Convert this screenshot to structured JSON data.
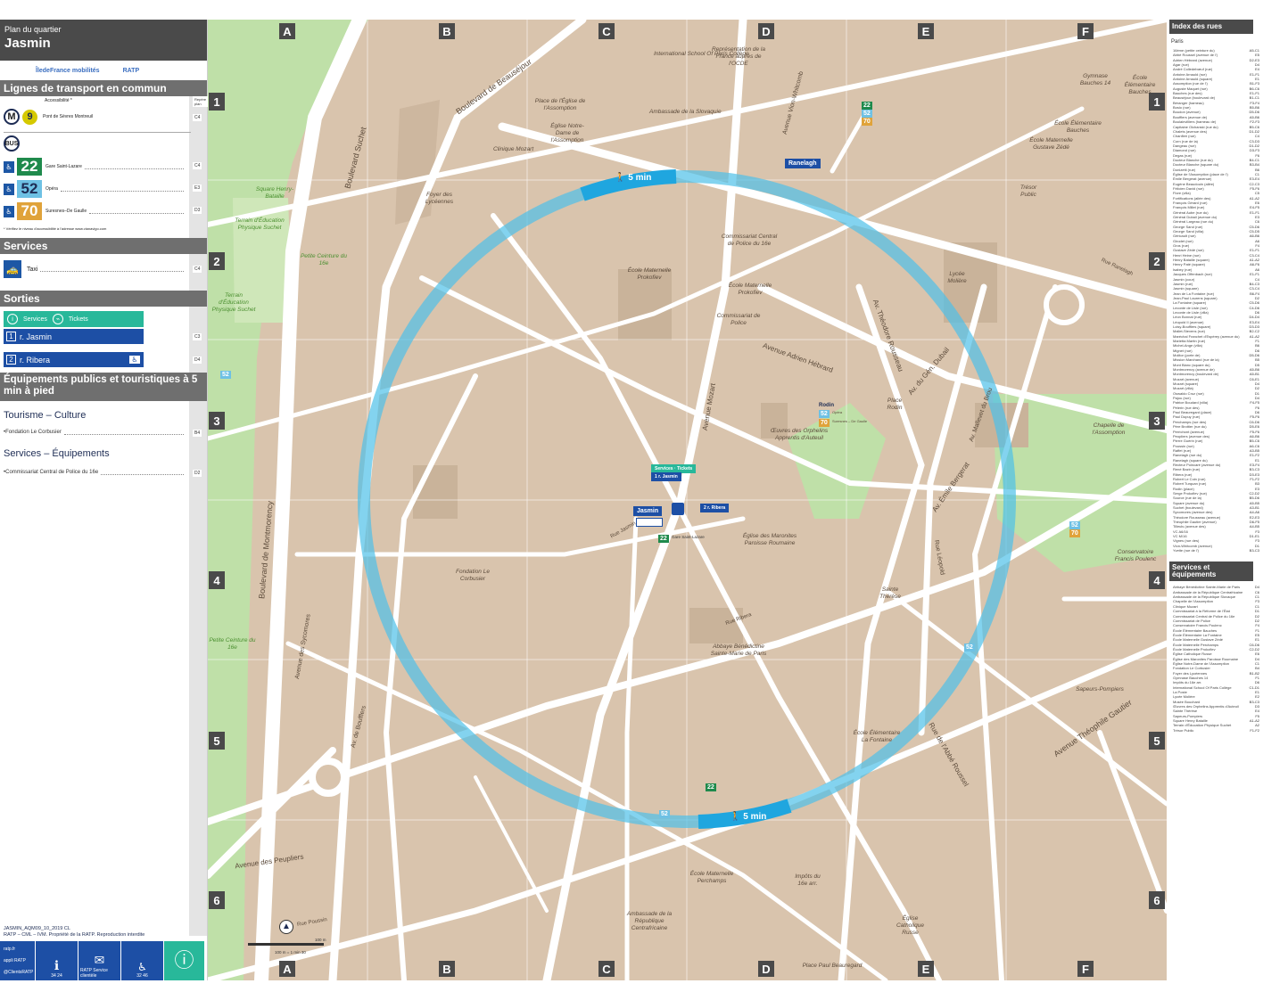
{
  "header": {
    "subtitle": "Plan du quartier",
    "title": "Jasmin"
  },
  "logos": {
    "idf": "ÎledeFrance mobilités",
    "ratp": "RATP"
  },
  "transport": {
    "section": "Lignes de transport en commun",
    "refs_label": "Repère plan",
    "accessibility_label": "Accessibilité *",
    "metro": {
      "line": "9",
      "direction": "Pont de Sèvres Montreuil",
      "ref": "C4"
    },
    "bus_label": "BUS",
    "bus_lines": [
      {
        "line": "22",
        "color": "#1f8a4c",
        "dest": "Gare Saint-Lazare",
        "ref": "C4"
      },
      {
        "line": "52",
        "color": "#6ec1e4",
        "dest": "Opéra",
        "ref": "E3"
      },
      {
        "line": "70",
        "color": "#e0a33a",
        "dest": "Suresnes–De Gaulle",
        "ref": "D3"
      }
    ],
    "note": "* Vérifiez le niveau d'accessibilité à l'adresse www.vianavigo.com"
  },
  "services": {
    "section": "Services",
    "taxi": "Taxi",
    "taxi_ref": "C4"
  },
  "exits": {
    "section": "Sorties",
    "services_btn": "Services",
    "tickets_btn": "Tickets",
    "list": [
      {
        "num": "1",
        "label": "r. Jasmin",
        "ref": "C3"
      },
      {
        "num": "2",
        "label": "r. Ribera",
        "ref": "D4"
      }
    ]
  },
  "equipements": {
    "section": "Équipements publics et touristiques à 5 min à pied",
    "tourisme": "Tourisme – Culture",
    "tourisme_items": [
      {
        "label": "Fondation Le Corbusier",
        "ref": "B4"
      }
    ],
    "servequip": "Services – Équipements",
    "servequip_items": [
      {
        "label": "Commissariat Central de Police du 16e",
        "ref": "D2"
      }
    ]
  },
  "footer": {
    "line1": "JASMIN_AQM09_10_2019 CL",
    "line2": "RATP – CML – IVM. Propriété de la RATP. Reproduction interdite",
    "contacts": [
      "ratp.fr",
      "appli RATP",
      "@ClientsRATP",
      "34 24",
      "RATP Service clientèle",
      "32 46"
    ]
  },
  "map": {
    "columns": [
      "A",
      "B",
      "C",
      "D",
      "E",
      "F"
    ],
    "rows": [
      "1",
      "2",
      "3",
      "4",
      "5",
      "6"
    ],
    "walk_label": "5 min",
    "station": "Jasmin",
    "station_exit1": "r. Jasmin",
    "station_exit2": "r. Ribera",
    "bus_stop_gsl": "Gare Saint-Lazare",
    "ranelagh": "Ranelagh",
    "rodin": "Rodin",
    "rodin_opera": "Opéra",
    "rodin_suresnes": "Suresnes – De Gaulle",
    "streets": [
      "Boulevard de Beauséjour",
      "Boulevard Suchet",
      "Boulevard de Montmorency",
      "Avenue Mozart",
      "Avenue Adrien Hébrard",
      "Av. Théodore Rousseau",
      "Av. du Gén. Dubail",
      "Av. Émile Bergerat",
      "Av. Mallevet du Brou",
      "Avenue Théophile Gautier",
      "Rue de l'Abbé Roussel",
      "Avenue des Peupliers",
      "Avenue des Sycomores",
      "Av. de Boufflers",
      "Rue Ranelagh",
      "Rue Poussin",
      "Rue Jasmin",
      "Rue Ribera",
      "Rue Poussin",
      "Rue Raffet",
      "Rue du Docteur Blanche",
      "Rue Henri Heine",
      "Rue Leconte de Lisle",
      "Rue George Sand",
      "Rue Perchamps",
      "Rue Léopold",
      "Rue de l'Assomption",
      "Avenue Vion-Whitcomb",
      "Rue Poussin",
      "Rue Mallet-Stevens",
      "Rue du Docteur Blanche",
      "Avenue des Tilleuls",
      "Rue Raffet",
      "Rue Leconte de Lisle",
      "Rue Théodore Rousseau"
    ],
    "places": [
      "International School Of Paris Collège",
      "Représentation de la France auprès de l'OCDE",
      "Ambassade de Slovaquie",
      "Ambassade de la Slovaquie",
      "Place de l'Église de l'Assomption",
      "Église Notre-Dame de l'Assomption",
      "Clinique Mozart",
      "Foyer des Lycéennes",
      "Square Henry-Bataille",
      "Terrain d'Éducation Physique Suchet",
      "Petite Ceinture du 16e",
      "Terrain d'Éducation Physique Suchet",
      "Commissariat Central de Police du 16e",
      "École Maternelle Prokofiev",
      "École Maternelle Prokofiev",
      "Commissariat de Police",
      "Lycée Molière",
      "Trésor Public",
      "Gymnase Bauches 14",
      "École Élémentaire Bauches",
      "École Élémentaire Bauches",
      "École Maternelle Gustave Zédé",
      "Chapelle de l'Assomption",
      "Œuvres des Orphelins Apprentis d'Auteuil",
      "Église des Maronites Paroisse Roumaine",
      "Fondation Le Corbusier",
      "Sainte Thérèse",
      "Conservatoire Francis Poulenc",
      "Abbaye Bénédictine Sainte-Marie de Paris",
      "Sapeurs-Pompiers",
      "École Élémentaire La Fontaine",
      "École Maternelle Perchamps",
      "Ambassade de la République Centrafricaine",
      "Impôts du 16e arr.",
      "Église Catholique Russe",
      "Petite Ceinture du 16e",
      "Place Rodin",
      "Place Paul Beauregard",
      "Villa de la Réunion",
      "Place de l'Église"
    ],
    "scale": "100 m = 1 min 30",
    "scale_end": "100 m"
  },
  "index": {
    "title": "Index des rues",
    "city": "Paris",
    "streets": [
      [
        "16ème (petite ceinture du)",
        "A5-C1"
      ],
      [
        "Abbé Roussel (avenue de l')",
        "E5"
      ],
      [
        "Adrien Hébrard (avenue)",
        "D2-E3"
      ],
      [
        "Agar (rue)",
        "D4"
      ],
      [
        "André Colledebœuf (rue)",
        "E4"
      ],
      [
        "Antoine Arnauld (rue)",
        "E1-F1"
      ],
      [
        "Antoine Arnauld (square)",
        "E1"
      ],
      [
        "Assomption (rue de l')",
        "B1-F3"
      ],
      [
        "Auguste Maquet (rue)",
        "B6-C6"
      ],
      [
        "Bauches (rue des)",
        "E1-F1"
      ],
      [
        "Beauséjour (boulevard de)",
        "B1-C1"
      ],
      [
        "Béranger (hameau)",
        "F3-F4"
      ],
      [
        "Bosio (rue)",
        "B5-B6"
      ],
      [
        "Boudon (avenue)",
        "D5-D6"
      ],
      [
        "Boufflers (avenue de)",
        "A5-B6"
      ],
      [
        "Boulainvilliers (hameau de)",
        "F2-F3"
      ],
      [
        "Capitaine Olchanski (rue du)",
        "B5-C6"
      ],
      [
        "Chalets (avenue des)",
        "D1-D2"
      ],
      [
        "Chanfleri (rue)",
        "C4"
      ],
      [
        "Corn (rue de la)",
        "C3-D3"
      ],
      [
        "Dangeau (rue)",
        "D1-D2"
      ],
      [
        "Diamond (rue)",
        "D3-F3"
      ],
      [
        "Degas (rue)",
        "F6"
      ],
      [
        "Docteur Blanche (rue du)",
        "B4-C1"
      ],
      [
        "Docteur Blanche (square du)",
        "B3-B4"
      ],
      [
        "Donizetti (rue)",
        "B6"
      ],
      [
        "Église de l'Assomption (place de l')",
        "C1"
      ],
      [
        "Émile Bergerat (avenue)",
        "E3-E4"
      ],
      [
        "Eugène Beaudouin (allée)",
        "C2-C3"
      ],
      [
        "Félicien David (rue)",
        "F5-F6"
      ],
      [
        "Flore (villa)",
        "C5"
      ],
      [
        "Fortifications (allée des)",
        "A1-A2"
      ],
      [
        "François Gérard (rue)",
        "E6"
      ],
      [
        "François Millet (rue)",
        "E4-F5"
      ],
      [
        "Général Aube (rue du)",
        "E1-F1"
      ],
      [
        "Général Dubail (avenue du)",
        "E3"
      ],
      [
        "Général Largeau (rue du)",
        "C6"
      ],
      [
        "George Sand (rue)",
        "C5-D6"
      ],
      [
        "George Sand (villa)",
        "C5-D5"
      ],
      [
        "Géricault (rue)",
        "A6-B6"
      ],
      [
        "Girodet (rue)",
        "A6"
      ],
      [
        "Gros (rue)",
        "F4"
      ],
      [
        "Gustave Zédé (rue)",
        "E1-F1"
      ],
      [
        "Henri Heine (rue)",
        "C3-C4"
      ],
      [
        "Henry Bataille (square)",
        "A1-A2"
      ],
      [
        "Henry Paté (square)",
        "A6-F6"
      ],
      [
        "Isabey (rue)",
        "A6"
      ],
      [
        "Jacques Offenbach (rue)",
        "E1-F1"
      ],
      [
        "Jasmin (cour)",
        "C4"
      ],
      [
        "Jasmin (rue)",
        "B4-C3"
      ],
      [
        "Jasmin (square)",
        "C3-C4"
      ],
      [
        "Jean de La Fontaine (rue)",
        "B6-F4"
      ],
      [
        "Jean-Paul Laurens (square)",
        "D2"
      ],
      [
        "La Fontaine (square)",
        "C5-D6"
      ],
      [
        "Leconte de Lisle (rue)",
        "C4-D6"
      ],
      [
        "Leconte de Lisle (villa)",
        "D6"
      ],
      [
        "Léon Bonnat (rue)",
        "D4-D4"
      ],
      [
        "Léopold II (avenue)",
        "E3-E4"
      ],
      [
        "Loisy-Boufflers (square)",
        "D3-D3"
      ],
      [
        "Mallet-Stevens (rue)",
        "B2-C2"
      ],
      [
        "Maréchal Franchet d'Espérey (avenue du)",
        "A1-A2"
      ],
      [
        "Marietta Martin (rue)",
        "F1"
      ],
      [
        "Michel-Ange (villa)",
        "B6"
      ],
      [
        "Mignet (rue)",
        "D6"
      ],
      [
        "Molitor (porte de)",
        "D5-D6"
      ],
      [
        "Mission Marchand (rue de la)",
        "B5"
      ],
      [
        "Mont Blanc (square du)",
        "D5"
      ],
      [
        "Montmorency (avenue de)",
        "A5-B6"
      ],
      [
        "Montmorency (boulevard de)",
        "A5-B1"
      ],
      [
        "Mozart (avenue)",
        "C6-E1"
      ],
      [
        "Mozart (square)",
        "D4"
      ],
      [
        "Mozart (villa)",
        "D2"
      ],
      [
        "Oswaldo Cruz (rue)",
        "D1"
      ],
      [
        "Pajou (rue)",
        "D4"
      ],
      [
        "Patrice Boudard (villa)",
        "F4-F5"
      ],
      [
        "Pèlerin (rue des)",
        "F6"
      ],
      [
        "Paul Beauregard (place)",
        "D6"
      ],
      [
        "Paul Dupuy (rue)",
        "F5-F6"
      ],
      [
        "Perchamps (rue des)",
        "C6-D6"
      ],
      [
        "Père Brottier (rue du)",
        "D5-E6"
      ],
      [
        "Perrichont (avenue)",
        "F5-F6"
      ],
      [
        "Peupliers (avenue des)",
        "A6-B6"
      ],
      [
        "Pierre Guérin (rue)",
        "B5-C6"
      ],
      [
        "Poussin (rue)",
        "A6-C6"
      ],
      [
        "Raffet (rue)",
        "A3-B5"
      ],
      [
        "Ranelagh (rue du)",
        "E1-F2"
      ],
      [
        "Ranelagh (square du)",
        "E1"
      ],
      [
        "Recteur Poincaré (avenue du)",
        "E3-F4"
      ],
      [
        "René Bazin (rue)",
        "B3-C3"
      ],
      [
        "Ribera (rue)",
        "D3-E3"
      ],
      [
        "Robert Le Coin (rue)",
        "F1-F2"
      ],
      [
        "Robert Turquan (rue)",
        "B3"
      ],
      [
        "Rodin (place)",
        "E3"
      ],
      [
        "Serge Prokofiev (rue)",
        "C2-D2"
      ],
      [
        "Source (rue de la)",
        "B5-D6"
      ],
      [
        "Square (avenue du)",
        "A5-B5"
      ],
      [
        "Suchet (boulevard)",
        "A3-B1"
      ],
      [
        "Sycomores (avenue des)",
        "A4-A6"
      ],
      [
        "Théodore Rousseau (avenue)",
        "E2-E3"
      ],
      [
        "Théophile Gautier (avenue)",
        "D6-F5"
      ],
      [
        "Tilleuls (avenue des)",
        "A4-B5"
      ],
      [
        "VC A6/16",
        "F3"
      ],
      [
        "VC M/16",
        "D1-E1"
      ],
      [
        "Vignes (rue des)",
        "F3"
      ],
      [
        "Vion-Whitcomb (avenue)",
        "D1"
      ],
      [
        "Yvette (rue de l')",
        "B3-C3"
      ]
    ],
    "services_title": "Services et équipements",
    "services": [
      [
        "Abbaye Bénédictine Sainte-Marie de Paris",
        "D4"
      ],
      [
        "Ambassade de la République Centrafricaine",
        "C6"
      ],
      [
        "Ambassade de la République Slovaque",
        "C1"
      ],
      [
        "Chapelle de l'Assomption",
        "F3"
      ],
      [
        "Clinique Mozart",
        "C1"
      ],
      [
        "Commissariat à la Réforme de l'État",
        "D1"
      ],
      [
        "Commissariat Central de Police du 16e",
        "D2"
      ],
      [
        "Commissariat de Police",
        "D2"
      ],
      [
        "Conservatoire Francis Poulenc",
        "F4"
      ],
      [
        "École Élémentaire Bauches",
        "F1"
      ],
      [
        "École Élémentaire La Fontaine",
        "E5"
      ],
      [
        "École Maternelle Gustave Zédé",
        "E1"
      ],
      [
        "École Maternelle Perchamps",
        "C6-D6"
      ],
      [
        "École Maternelle Prokofiev",
        "C2-D2"
      ],
      [
        "Église Catholique Russe",
        "E6"
      ],
      [
        "Église des Maronites Paroisse Roumaine",
        "D4"
      ],
      [
        "Église Notre-Dame de l'Assomption",
        "C1"
      ],
      [
        "Fondation Le Corbusier",
        "B4"
      ],
      [
        "Foyer des Lycéennes",
        "B1-B2"
      ],
      [
        "Gymnase Bauches 14",
        "F1"
      ],
      [
        "Impôts du 16e arr.",
        "D6"
      ],
      [
        "International School Of Paris Collège",
        "C1-D1"
      ],
      [
        "La Poste",
        "E1"
      ],
      [
        "Lycée Molière",
        "E2"
      ],
      [
        "Musée Bouchard",
        "B3-C3"
      ],
      [
        "Œuvres des Orphelins Apprentis d'Auteuil",
        "D3"
      ],
      [
        "Sainte Thérèse",
        "E4"
      ],
      [
        "Sapeurs-Pompiers",
        "F5"
      ],
      [
        "Square Henry Bataille",
        "A1-A2"
      ],
      [
        "Terrain d'Éducation Physique Suchet",
        "A2"
      ],
      [
        "Trésor Public",
        "F1-F2"
      ]
    ]
  },
  "colors": {
    "walk_ring": "#4fc0e8",
    "block": "#d9c4ad",
    "street": "#ffffff",
    "park": "#bfe0a8",
    "building": "#c9b39a"
  }
}
